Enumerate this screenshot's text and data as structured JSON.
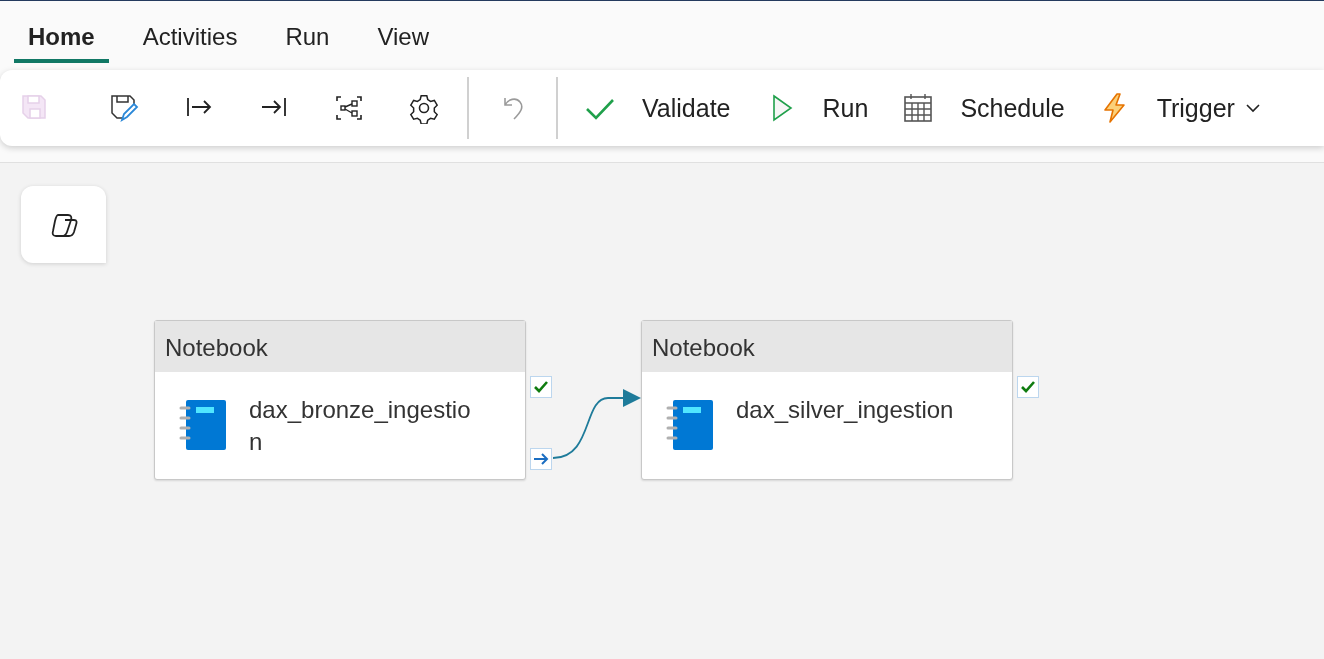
{
  "tabs": [
    {
      "label": "Home",
      "selected": true
    },
    {
      "label": "Activities",
      "selected": false
    },
    {
      "label": "Run",
      "selected": false
    },
    {
      "label": "View",
      "selected": false
    }
  ],
  "toolbar": [
    {
      "kind": "icon",
      "disabled": true
    },
    {
      "kind": "icon",
      "disabled": false
    },
    {
      "kind": "icon",
      "disabled": false
    },
    {
      "kind": "icon",
      "disabled": false
    },
    {
      "kind": "icon",
      "disabled": false
    },
    {
      "kind": "icon",
      "disabled": false
    },
    {
      "kind": "separator"
    },
    {
      "kind": "icon",
      "disabled": true
    },
    {
      "kind": "separator"
    },
    {
      "kind": "labeled",
      "label": "Validate",
      "disabled": false,
      "has_menu": false
    },
    {
      "kind": "labeled",
      "label": "Run",
      "disabled": false,
      "has_menu": false
    },
    {
      "kind": "labeled",
      "label": "Schedule",
      "disabled": false,
      "has_menu": false
    },
    {
      "kind": "labeled",
      "label": "Trigger",
      "disabled": false,
      "has_menu": true
    }
  ],
  "activities": [
    {
      "type": "Notebook",
      "name": "dax_bronze_ingestion",
      "ports": [
        {
          "kind": "success"
        },
        {
          "kind": "next"
        }
      ]
    },
    {
      "type": "Notebook",
      "name": "dax_silver_ingestion",
      "ports": [
        {
          "kind": "success"
        }
      ]
    }
  ]
}
